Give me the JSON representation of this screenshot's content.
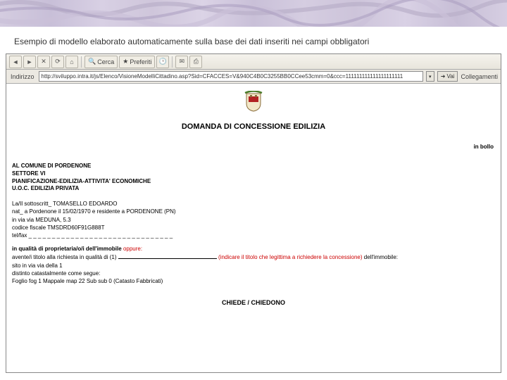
{
  "caption": "Esempio di modello elaborato automaticamente sulla base dei dati inseriti nei campi obbligatori",
  "toolbar": {
    "back_icon": "◄",
    "fwd_icon": "►",
    "stop_icon": "✕",
    "refresh_icon": "⟳",
    "home_icon": "⌂",
    "search_icon": "🔍",
    "fav_icon": "★",
    "hist_icon": "🕒",
    "mail_icon": "✉",
    "print_icon": "⎙",
    "search_label": "Cerca",
    "pref_label": "Preferiti"
  },
  "addrbar": {
    "label": "Indirizzo",
    "url": "http://sviluppo.intra.it/js/Elenco/VisioneModelliCittadino.asp?Sid=CFACCES=V&940C4B0C3255BB0CCee53cmm=0&ccc=111111111111111111111",
    "go_label": "Vai",
    "links_label": "Collegamenti"
  },
  "document": {
    "title": "DOMANDA DI CONCESSIONE EDILIZIA",
    "bollo": "in bollo",
    "addr_line1": "AL COMUNE DI PORDENONE",
    "addr_line2": "SETTORE VI",
    "addr_line3": "PIANIFICAZIONE-EDILIZIA-ATTIVITA' ECONOMICHE",
    "addr_line4": "U.O.C. EDILIZIA PRIVATA",
    "p1_l1": "La/Il sottoscritt_ TOMASELLO EDOARDO",
    "p1_l2": "nat_ a Pordenone il 15/02/1970 e residente a PORDENONE (PN)",
    "p1_l3": "in via via MEDUNA, 5.3",
    "p1_l4": "codice fiscale TMSDRD60F91G888T",
    "p1_l5": "tel/fax _ _ _ _ _ _ _ _ _ _ _ _ _ _ _ _ _ _ _ _ _ _ _ _ _ _ _ _ _ _ _",
    "p2_l1": "in qualità di proprietaria/o/i dell'immobile",
    "p2_l1_red": "oppure:",
    "p2_l2a": "avente/i titolo alla richiesta in qualità di (1)",
    "p2_l2_red": "(indicare il titolo che legittima a richiedere la concessione)",
    "p2_l2b": "dell'immobile:",
    "p2_l3": "sito in via via della 1",
    "p2_l4": "distinto catastalmente come segue:",
    "p2_l5": "Foglio fog 1 Mappale map 22 Sub sub 0 (Catasto Fabbricati)",
    "chiede": "CHIEDE / CHIEDONO"
  }
}
